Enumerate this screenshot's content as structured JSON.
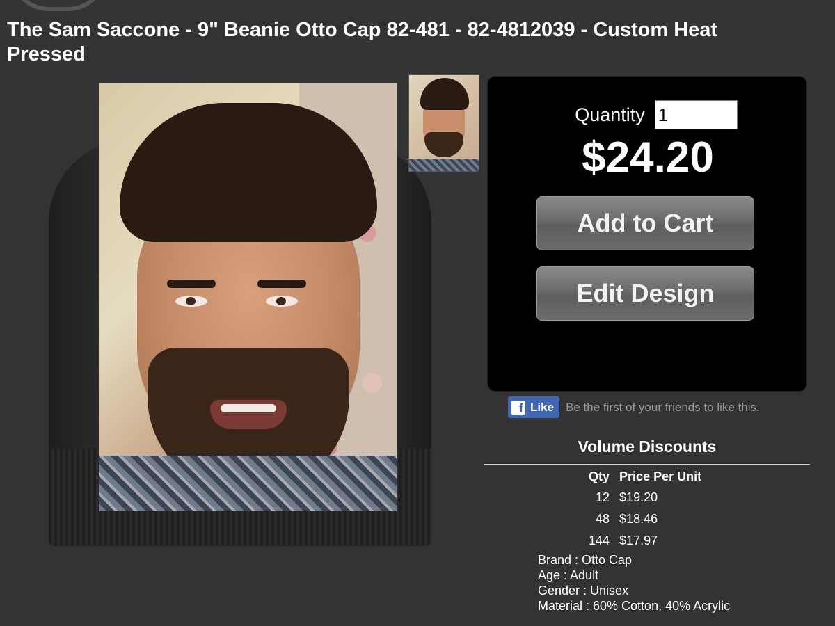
{
  "product": {
    "title": "The Sam Saccone - 9\" Beanie Otto Cap 82-481 - 82-4812039 - Custom Heat Pressed"
  },
  "purchase": {
    "quantity_label": "Quantity",
    "quantity_value": "1",
    "price": "$24.20",
    "add_to_cart_label": "Add to Cart",
    "edit_design_label": "Edit Design"
  },
  "social": {
    "like_button_label": "Like",
    "like_icon": "facebook-icon",
    "like_text": "Be the first of your friends to like this."
  },
  "discounts": {
    "title": "Volume Discounts",
    "headers": [
      "Qty",
      "Price Per Unit"
    ],
    "rows": [
      {
        "qty": "12",
        "price": "$19.20"
      },
      {
        "qty": "48",
        "price": "$18.46"
      },
      {
        "qty": "144",
        "price": "$17.97"
      }
    ]
  },
  "attributes": [
    "Brand : Otto Cap",
    "Age : Adult",
    "Gender : Unisex",
    "Material : 60% Cotton, 40% Acrylic"
  ],
  "colors": {
    "background": "#333333",
    "purchase_box": "#000000",
    "button_gray": "#6f6f6f",
    "facebook_blue": "#4267b2"
  }
}
